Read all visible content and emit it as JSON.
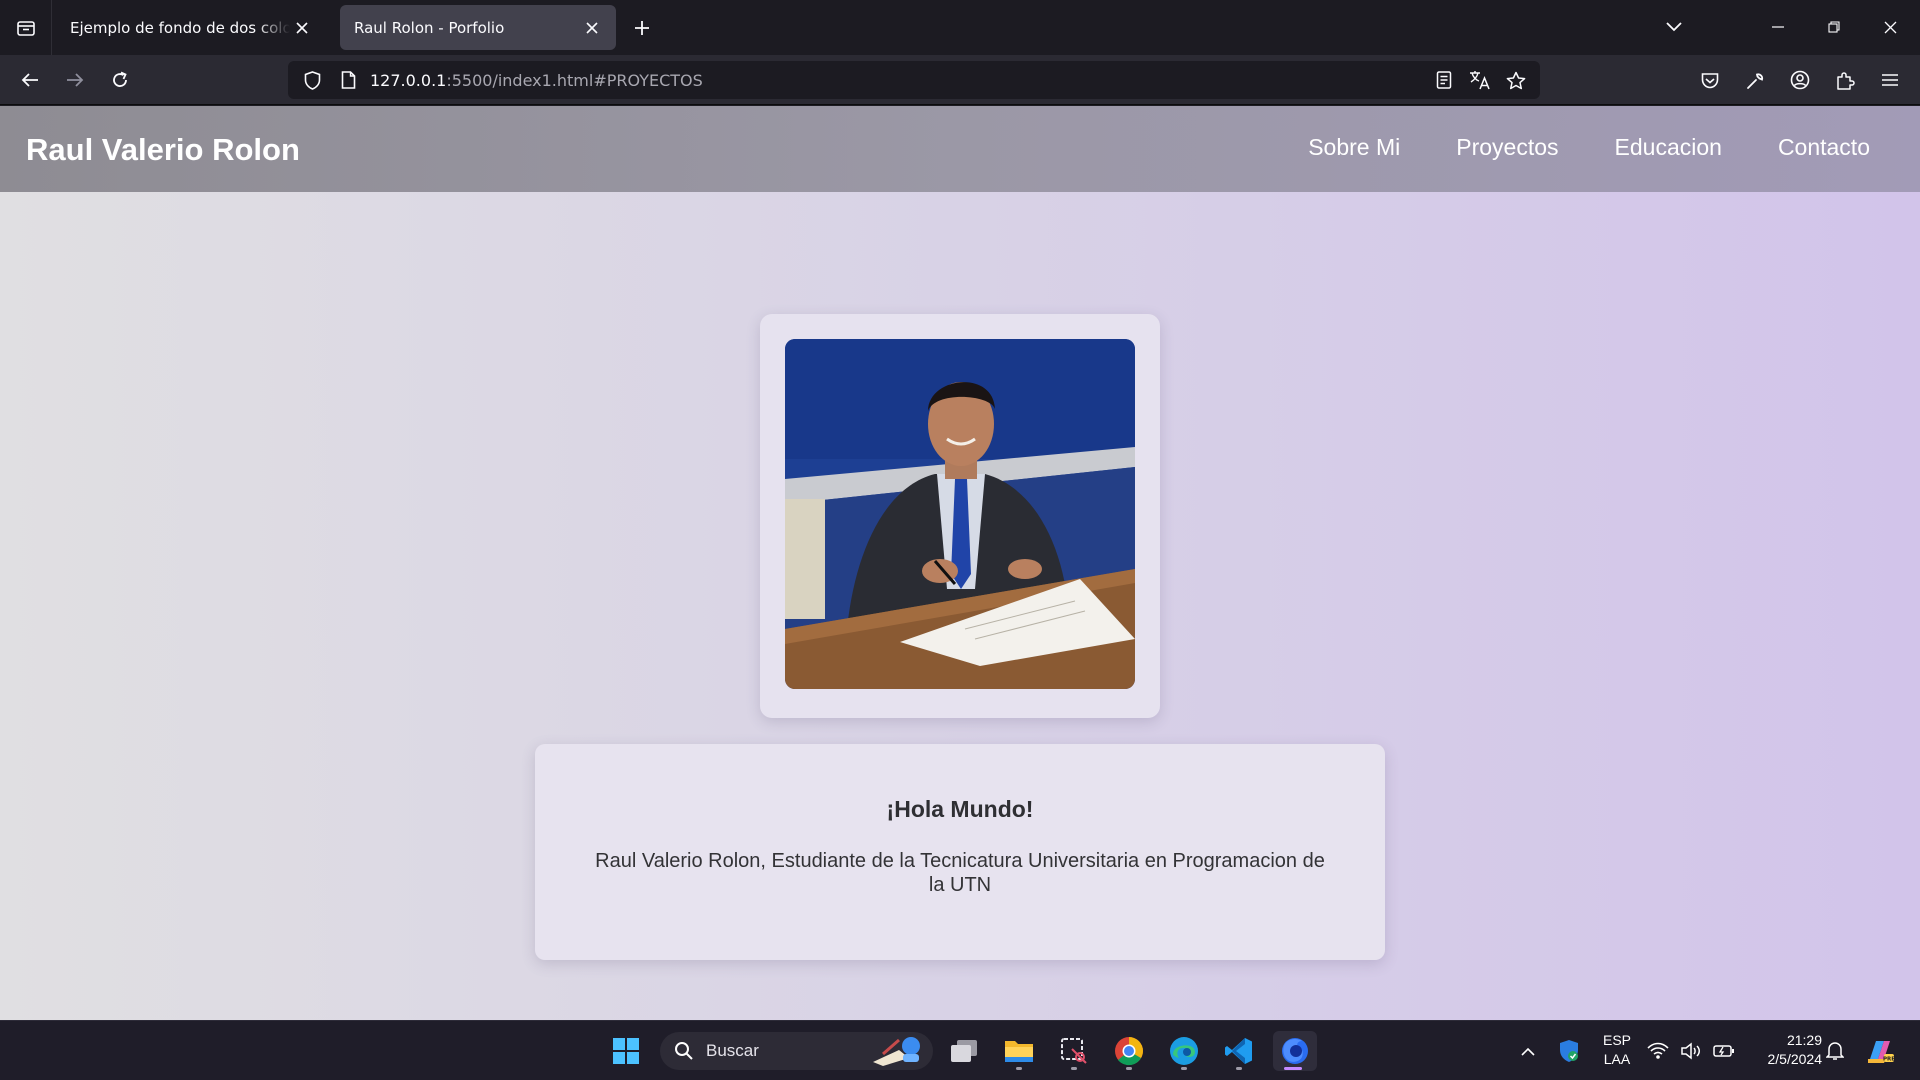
{
  "browser": {
    "tabs": [
      {
        "title": "Ejemplo de fondo de dos colores co",
        "active": false
      },
      {
        "title": "Raul Rolon - Porfolio",
        "active": true
      }
    ],
    "url": {
      "host": "127.0.0.1",
      "rest": ":5500/index1.html#PROYECTOS"
    }
  },
  "site": {
    "brand": "Raul Valerio Rolon",
    "nav": [
      "Sobre Mi",
      "Proyectos",
      "Educacion",
      "Contacto"
    ],
    "intro": {
      "title": "¡Hola Mundo!",
      "text": "Raul Valerio Rolon, Estudiante de la Tecnicatura Universitaria en Programacion de la UTN"
    }
  },
  "taskbar": {
    "search_placeholder": "Buscar",
    "language": "ESP",
    "layout": "LAA",
    "time": "21:29",
    "date": "2/5/2024"
  },
  "colors": {
    "accent": "#c58bff",
    "header": "#9b98a6",
    "page_bg": "#d8d2e6"
  }
}
